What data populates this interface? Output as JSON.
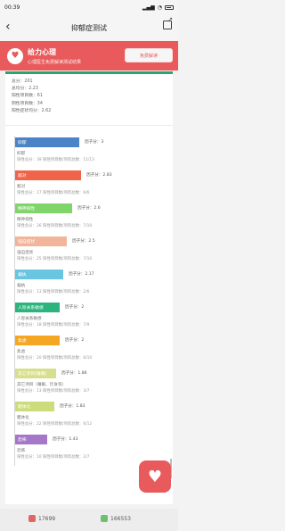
{
  "status": {
    "time": "00:39"
  },
  "nav": {
    "title": "抑郁症测试"
  },
  "banner": {
    "title": "给力心理",
    "subtitle": "心理医生免费解读测试结果",
    "button": "免费解读"
  },
  "summary": {
    "line1": "总分：201",
    "line2": "总均分：2.23",
    "line3": "阳性项目数：61",
    "line4": "阴性项目数：34",
    "line5": "阳性症状均分：2.62"
  },
  "factors": [
    {
      "label": "抑郁",
      "score": "因子分：3",
      "desc": "抑郁",
      "detail": "阳性总分：39 阳性项目数/项目总数：11/13",
      "color": "#4b83c6",
      "width": 72
    },
    {
      "label": "敌对",
      "score": "因子分：2.83",
      "desc": "敌对",
      "detail": "阳性总分：17 阳性项目数/项目总数：6/6",
      "color": "#f0654a",
      "width": 74
    },
    {
      "label": "精神病性",
      "score": "因子分：2.6",
      "desc": "精神病性",
      "detail": "阳性总分：26 阳性项目数/项目总数：7/10",
      "color": "#7fd56a",
      "width": 64
    },
    {
      "label": "强迫症状",
      "score": "因子分：2.5",
      "desc": "强迫症状",
      "detail": "阳性总分：25 阳性项目数/项目总数：7/10",
      "color": "#f2b49a",
      "width": 58
    },
    {
      "label": "偏执",
      "score": "因子分：2.17",
      "desc": "偏执",
      "detail": "阳性总分：13 阳性项目数/项目总数：2/6",
      "color": "#68c6e0",
      "width": 54
    },
    {
      "label": "人际关系敏感",
      "score": "因子分：2",
      "desc": "人际关系敏感",
      "detail": "阳性总分：18 阳性项目数/项目总数：7/9",
      "color": "#2db37e",
      "width": 50
    },
    {
      "label": "焦虑",
      "score": "因子分：2",
      "desc": "焦虑",
      "detail": "阳性总分：20 阳性项目数/项目总数：6/10",
      "color": "#f5a623",
      "width": 50
    },
    {
      "label": "其它项目(睡眠)",
      "score": "因子分：1.86",
      "desc": "其它项目（睡眠、饮食等）",
      "detail": "阳性总分：13 阳性项目数/项目总数：3/7",
      "color": "#d7df8d",
      "width": 46
    },
    {
      "label": "躯体化",
      "score": "因子分：1.83",
      "desc": "躯体化",
      "detail": "阳性总分：22 阳性项目数/项目总数：6/12",
      "color": "#cddc7a",
      "width": 44
    },
    {
      "label": "恐怖",
      "score": "因子分：1.43",
      "desc": "恐怖",
      "detail": "阳性总分：10 阳性项目数/项目总数：2/7",
      "color": "#a477c9",
      "width": 36
    }
  ],
  "bottom": {
    "dislike_count": "17699",
    "like_count": "166553"
  }
}
